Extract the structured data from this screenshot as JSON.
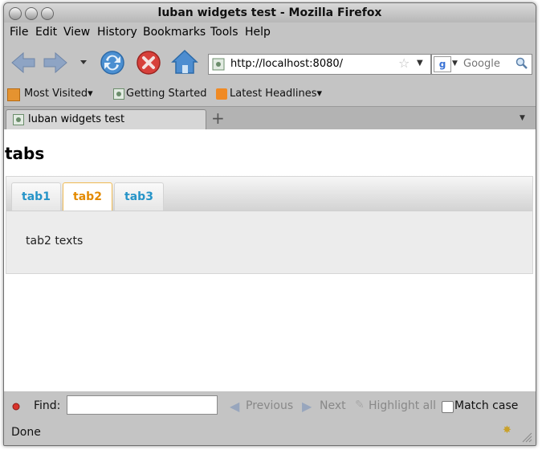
{
  "window": {
    "title": "luban widgets test - Mozilla Firefox"
  },
  "menu": [
    {
      "label": "File"
    },
    {
      "label": "Edit"
    },
    {
      "label": "View"
    },
    {
      "label": "History"
    },
    {
      "label": "Bookmarks"
    },
    {
      "label": "Tools"
    },
    {
      "label": "Help"
    }
  ],
  "nav": {
    "url": "http://localhost:8080/",
    "search_placeholder": "Google"
  },
  "bookmarks": [
    {
      "label": "Most Visited▾"
    },
    {
      "label": "Getting Started"
    },
    {
      "label": "Latest Headlines▾"
    }
  ],
  "browser_tab": {
    "label": "luban widgets test"
  },
  "page": {
    "title": "tabs",
    "tabs": [
      {
        "label": "tab1"
      },
      {
        "label": "tab2"
      },
      {
        "label": "tab3"
      }
    ],
    "active_tab": "tab2",
    "panel_text": "tab2 texts"
  },
  "findbar": {
    "find_label": "Find:",
    "previous": "Previous",
    "next": "Next",
    "highlight": "Highlight all",
    "match_case": "Match case"
  },
  "status": {
    "text": "Done"
  },
  "colors": {
    "tab_text": "#2694c8",
    "active_tab_text": "#e38a00",
    "active_tab_border": "#f0bb54"
  }
}
